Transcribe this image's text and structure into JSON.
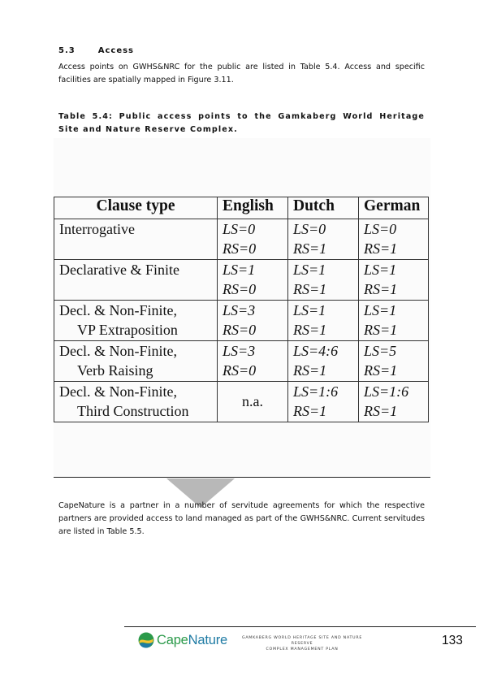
{
  "section": {
    "number": "5.3",
    "title": "Access"
  },
  "intro_paragraph": "Access points on GWHS&NRC for the public are listed in Table 5.4. Access and specific facilities are spatially mapped in Figure 3.11.",
  "table_caption": "Table 5.4: Public access points to the Gamkaberg World Heritage Site and Nature Reserve Complex.",
  "figure_table": {
    "headers": [
      "Clause type",
      "English",
      "Dutch",
      "German"
    ],
    "rows": [
      {
        "clause": [
          "Interrogative",
          ""
        ],
        "english": [
          "LS=0",
          "RS=0"
        ],
        "dutch": [
          "LS=0",
          "RS=1"
        ],
        "german": [
          "LS=0",
          "RS=1"
        ]
      },
      {
        "clause": [
          "Declarative & Finite",
          ""
        ],
        "english": [
          "LS=1",
          "RS=0"
        ],
        "dutch": [
          "LS=1",
          "RS=1"
        ],
        "german": [
          "LS=1",
          "RS=1"
        ]
      },
      {
        "clause": [
          "Decl. & Non-Finite,",
          "VP Extraposition"
        ],
        "english": [
          "LS=3",
          "RS=0"
        ],
        "dutch": [
          "LS=1",
          "RS=1"
        ],
        "german": [
          "LS=1",
          "RS=1"
        ]
      },
      {
        "clause": [
          "Decl. & Non-Finite,",
          "Verb Raising"
        ],
        "english": [
          "LS=3",
          "RS=0"
        ],
        "dutch": [
          "LS=4:6",
          "RS=1"
        ],
        "german": [
          "LS=5",
          "RS=1"
        ]
      },
      {
        "clause": [
          "Decl. & Non-Finite,",
          "Third Construction"
        ],
        "english": [
          "n.a."
        ],
        "dutch": [
          "LS=1:6",
          "RS=1"
        ],
        "german": [
          "LS=1:6",
          "RS=1"
        ]
      }
    ]
  },
  "second_paragraph": "CapeNature is a partner in a number of servitude agreements for which the respective partners are provided access to land managed as part of the GWHS&NRC. Current servitudes are listed in Table 5.5.",
  "footer": {
    "logo_cape": "Cape",
    "logo_nature": "Nature",
    "doc_title_line1": "GAMKABERG WORLD HERITAGE SITE AND NATURE RESERVE",
    "doc_title_line2": "COMPLEX MANAGEMENT PLAN",
    "page_number": "133"
  },
  "colors": {
    "logo_green": "#2b9a4a",
    "logo_blue": "#1f7ba4",
    "arrow_grey": "#b8b8b8"
  }
}
